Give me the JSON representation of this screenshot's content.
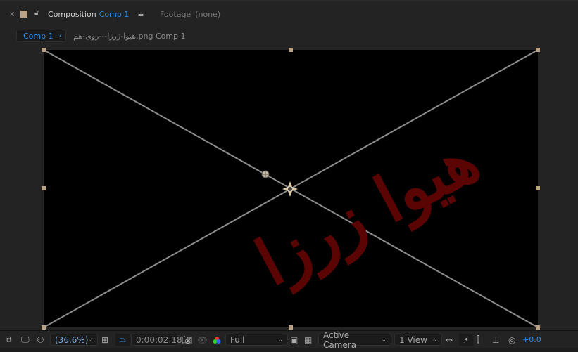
{
  "tabs": [
    {
      "label": "Composition",
      "name": "Comp 1",
      "active": true
    },
    {
      "label": "Footage",
      "name": "(none)",
      "active": false
    }
  ],
  "breadcrumb": {
    "current": "Comp 1",
    "path": "هیوا-زرزا---روی-هم.png Comp 1"
  },
  "watermark": "هیوا زرزا",
  "colors": {
    "accent": "#2d8ceb",
    "label_swatch": "#b9a384",
    "watermark": "#5a0404"
  },
  "toolbar": {
    "magnification": "(36.6%)",
    "timecode": "0:00:02:18",
    "resolution": "Full",
    "camera": "Active Camera",
    "views": "1 View",
    "exposure": "+0.0"
  }
}
